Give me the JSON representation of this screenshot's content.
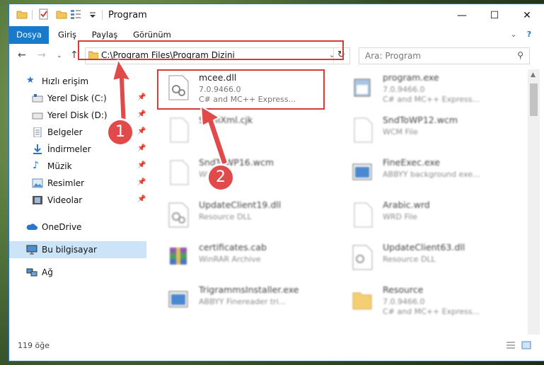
{
  "window": {
    "title": "Program"
  },
  "ribbon": {
    "tabs": [
      "Dosya",
      "Giriş",
      "Paylaş",
      "Görünüm"
    ]
  },
  "nav": {
    "address": "C:\\Program Files\\Program Dizini",
    "search_placeholder": "Ara: Program"
  },
  "sidebar": {
    "items": [
      {
        "label": "Hızlı erişim",
        "icon": "star-icon"
      },
      {
        "label": "Yerel Disk (C:)",
        "icon": "drive-icon"
      },
      {
        "label": "Yerel Disk (D:)",
        "icon": "drive-icon"
      },
      {
        "label": "Belgeler",
        "icon": "documents-icon"
      },
      {
        "label": "İndirmeler",
        "icon": "download-icon"
      },
      {
        "label": "Müzik",
        "icon": "music-icon"
      },
      {
        "label": "Resimler",
        "icon": "pictures-icon"
      },
      {
        "label": "Videolar",
        "icon": "video-icon"
      },
      {
        "label": "OneDrive",
        "icon": "cloud-icon"
      },
      {
        "label": "Bu bilgisayar",
        "icon": "computer-icon"
      },
      {
        "label": "Ağ",
        "icon": "network-icon"
      }
    ]
  },
  "files": [
    {
      "name": "mcee.dll",
      "line1": "7.0.9466.0",
      "line2": "C# and MC++ Express..."
    },
    {
      "name": "program.exe",
      "line1": "7.0.9466.0",
      "line2": "C# and MC++ Express..."
    },
    {
      "name": "ShellXml.cjk",
      "line1": "",
      "line2": ""
    },
    {
      "name": "SndToWP12.wcm",
      "line1": "WCM File",
      "line2": ""
    },
    {
      "name": "SndToWP16.wcm",
      "line1": "WCM File",
      "line2": ""
    },
    {
      "name": "FineExec.exe",
      "line1": "ABBYY background exe...",
      "line2": ""
    },
    {
      "name": "UpdateClient19.dll",
      "line1": "Resource DLL",
      "line2": ""
    },
    {
      "name": "Arabic.wrd",
      "line1": "WRD File",
      "line2": ""
    },
    {
      "name": "certificates.cab",
      "line1": "WinRAR Archive",
      "line2": ""
    },
    {
      "name": "UpdateClient63.dll",
      "line1": "Resource DLL",
      "line2": ""
    },
    {
      "name": "TrigrammsInstaller.exe",
      "line1": "ABBYY Finereader tri...",
      "line2": ""
    },
    {
      "name": "Resource",
      "line1": "7.0.9466.0",
      "line2": "C# and MC++ Express..."
    }
  ],
  "markers": [
    "1",
    "2"
  ],
  "status": {
    "count": "119 öğe"
  },
  "colors": {
    "accent": "#1979ca",
    "highlight": "#d43b3b",
    "selected": "#cce4f7"
  }
}
